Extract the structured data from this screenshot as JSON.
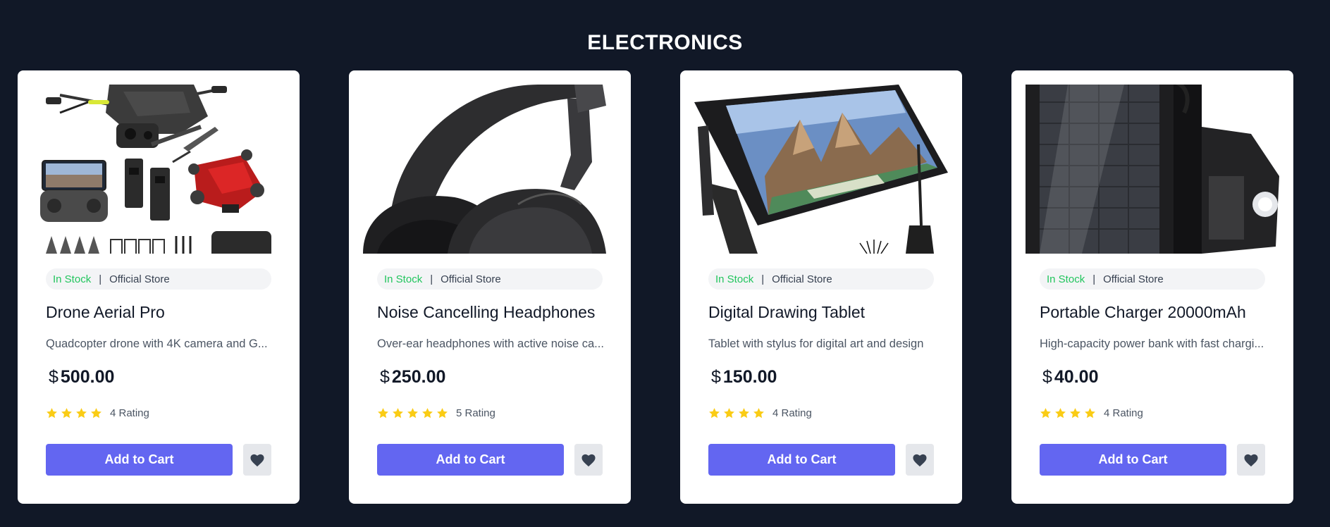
{
  "section": {
    "title": "ELECTRONICS"
  },
  "colors": {
    "background": "#111827",
    "accent": "#6366f1",
    "in_stock": "#22c55e",
    "star": "#facc15"
  },
  "products": [
    {
      "image_icon": "drone-photo",
      "stock": "In Stock",
      "separator": "|",
      "store": "Official Store",
      "name": "Drone Aerial Pro",
      "description": "Quadcopter drone with 4K camera and G...",
      "currency": "$",
      "price": "500.00",
      "stars": 4,
      "rating_label": "4 Rating",
      "add_to_cart": "Add to Cart",
      "wishlist_icon": "heart-icon"
    },
    {
      "image_icon": "headphones-photo",
      "stock": "In Stock",
      "separator": "|",
      "store": "Official Store",
      "name": "Noise Cancelling Headphones",
      "description": "Over-ear headphones with active noise ca...",
      "currency": "$",
      "price": "250.00",
      "stars": 5,
      "rating_label": "5 Rating",
      "add_to_cart": "Add to Cart",
      "wishlist_icon": "heart-icon"
    },
    {
      "image_icon": "drawing-tablet-photo",
      "stock": "In Stock",
      "separator": "|",
      "store": "Official Store",
      "name": "Digital Drawing Tablet",
      "description": "Tablet with stylus for digital art and design",
      "currency": "$",
      "price": "150.00",
      "stars": 4,
      "rating_label": "4 Rating",
      "add_to_cart": "Add to Cart",
      "wishlist_icon": "heart-icon"
    },
    {
      "image_icon": "solar-charger-photo",
      "stock": "In Stock",
      "separator": "|",
      "store": "Official Store",
      "name": "Portable Charger 20000mAh",
      "description": "High-capacity power bank with fast chargi...",
      "currency": "$",
      "price": "40.00",
      "stars": 4,
      "rating_label": "4 Rating",
      "add_to_cart": "Add to Cart",
      "wishlist_icon": "heart-icon"
    }
  ]
}
